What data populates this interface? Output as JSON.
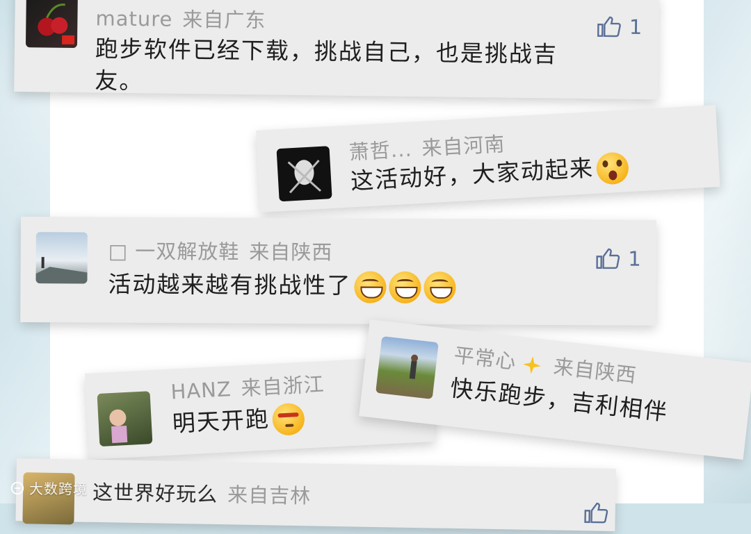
{
  "comments": [
    {
      "name": "mature",
      "origin": "来自广东",
      "text_line1": "跑步软件已经下载，挑战自己，也是挑战吉",
      "text_line2": "友。",
      "likes": "1",
      "avatar": "cherry-avatar"
    },
    {
      "name": "萧哲...",
      "origin": "来自河南",
      "text": "这活动好，大家动起来",
      "likes": "",
      "avatar": "mask-avatar"
    },
    {
      "name": "□ 一双解放鞋",
      "origin": "来自陕西",
      "text": "活动越来越有挑战性了",
      "likes": "1",
      "avatar": "landscape-avatar"
    },
    {
      "name": "HANZ",
      "origin": "来自浙江",
      "text": "明天开跑",
      "likes": "",
      "avatar": "child-avatar"
    },
    {
      "name": "平常心",
      "origin": "来自陕西",
      "text": "快乐跑步，吉利相伴",
      "likes": "",
      "avatar": "hiker-avatar"
    },
    {
      "name": "这世界好玩么",
      "origin": "来自吉林",
      "text": "",
      "likes": "",
      "avatar": "sunset-avatar"
    }
  ],
  "watermark": "大数跨境",
  "colors": {
    "card_bg": "#ececec",
    "name_gray": "#9a9a9a",
    "like_blue": "#5a6f97"
  }
}
